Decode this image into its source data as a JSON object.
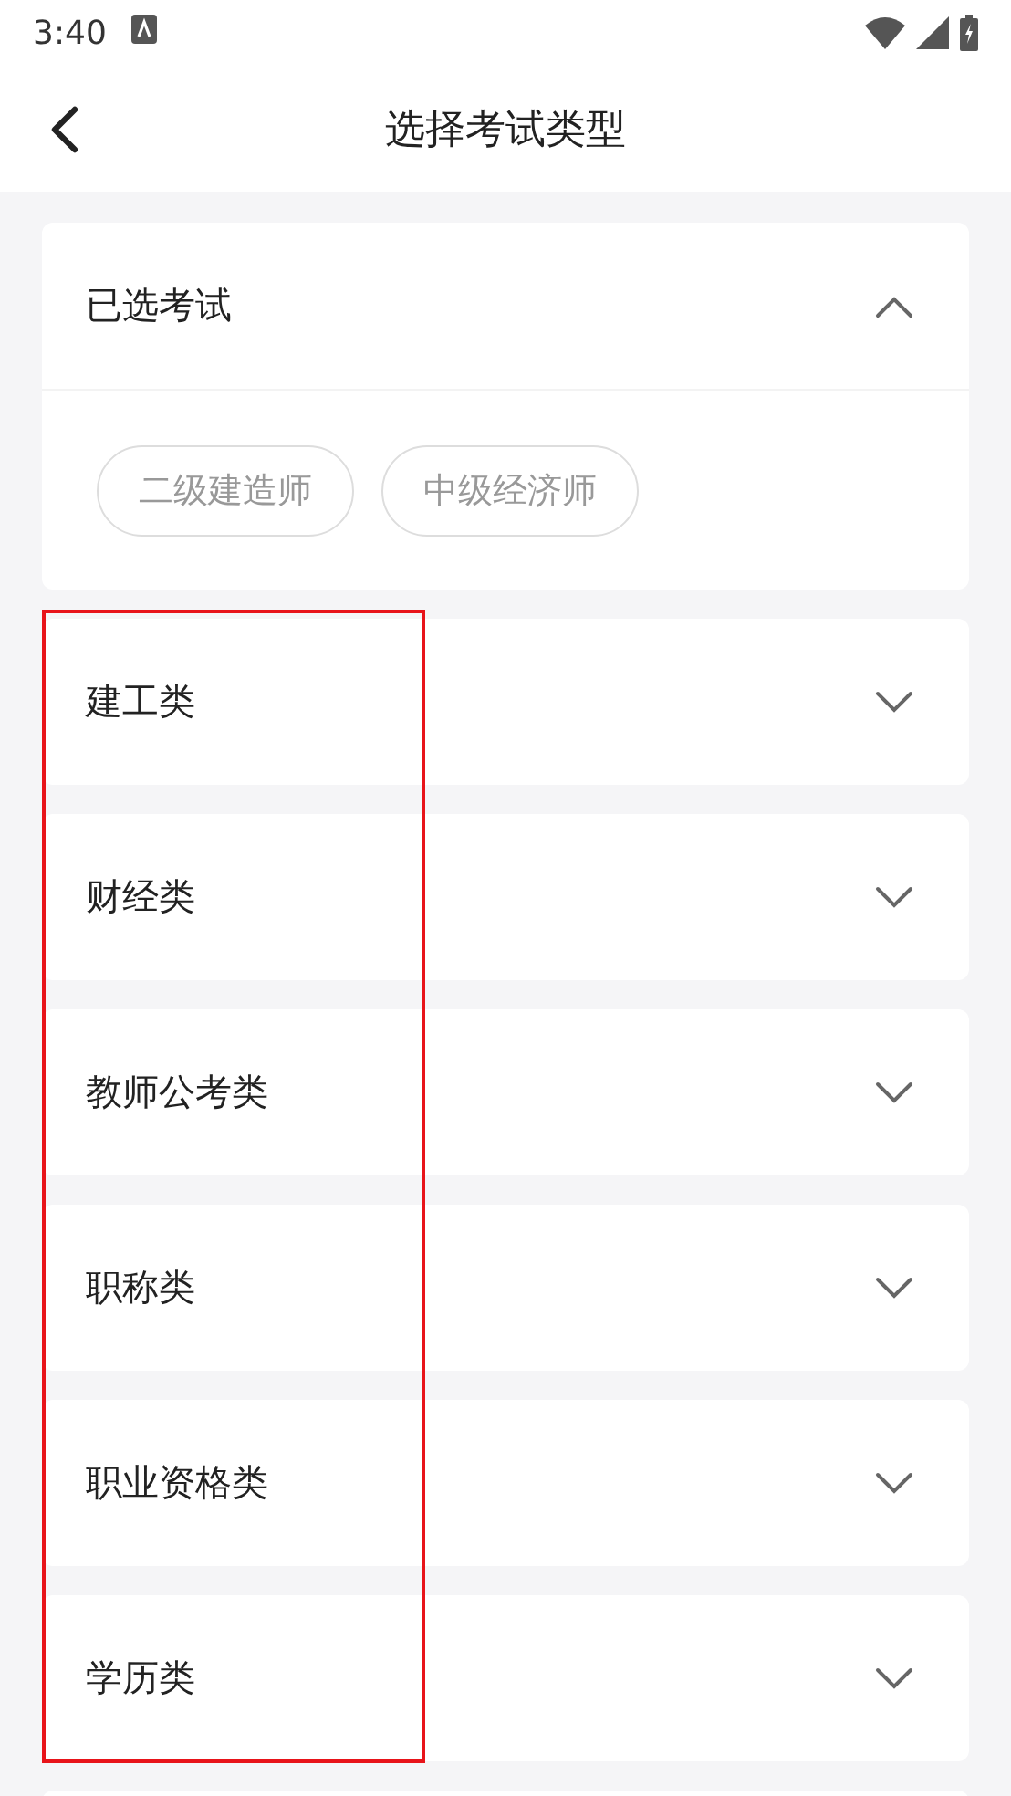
{
  "status_bar": {
    "time": "3:40"
  },
  "header": {
    "title": "选择考试类型"
  },
  "selected_section": {
    "title": "已选考试",
    "expanded": true,
    "chips": [
      "二级建造师",
      "中级经济师"
    ]
  },
  "categories": [
    {
      "label": "建工类",
      "expanded": false
    },
    {
      "label": "财经类",
      "expanded": false
    },
    {
      "label": "教师公考类",
      "expanded": false
    },
    {
      "label": "职称类",
      "expanded": false
    },
    {
      "label": "职业资格类",
      "expanded": false
    },
    {
      "label": "学历类",
      "expanded": false
    }
  ],
  "annotation": {
    "kind": "rectangle"
  }
}
